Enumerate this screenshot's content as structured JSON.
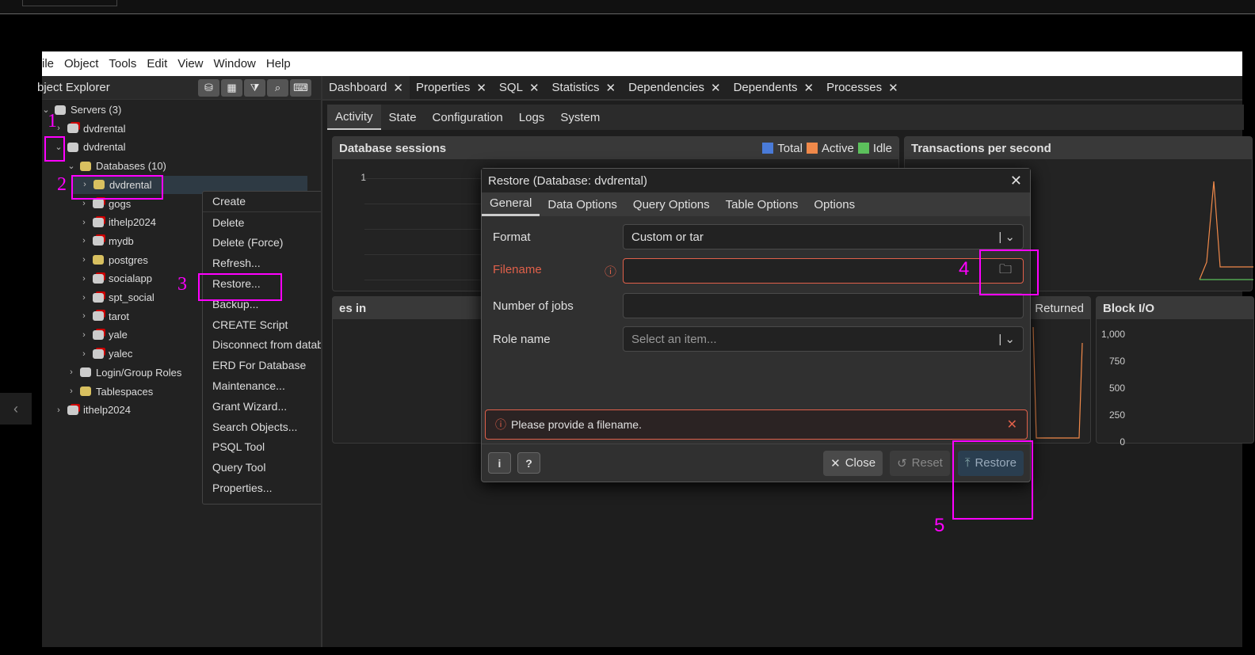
{
  "menubar": [
    "ile",
    "Object",
    "Tools",
    "Edit",
    "View",
    "Window",
    "Help"
  ],
  "explorer": {
    "title": "bject Explorer",
    "toolbar": [
      "query-tool-icon",
      "table-icon",
      "filter-icon",
      "search-icon",
      "terminal-icon"
    ],
    "tree": [
      {
        "label": "Servers (3)",
        "level": 0,
        "icon": "servers"
      },
      {
        "label": "dvdrental",
        "level": 1,
        "icon": "server-disconnected"
      },
      {
        "label": "dvdrental",
        "level": 1,
        "icon": "server-connected"
      },
      {
        "label": "Databases (10)",
        "level": 2,
        "icon": "databases"
      },
      {
        "label": "dvdrental",
        "level": 3,
        "icon": "database",
        "selected": true
      },
      {
        "label": "gogs",
        "level": 3,
        "icon": "database-disconnected"
      },
      {
        "label": "ithelp2024",
        "level": 3,
        "icon": "database-disconnected"
      },
      {
        "label": "mydb",
        "level": 3,
        "icon": "database-disconnected"
      },
      {
        "label": "postgres",
        "level": 3,
        "icon": "database"
      },
      {
        "label": "socialapp",
        "level": 3,
        "icon": "database-disconnected"
      },
      {
        "label": "spt_social",
        "level": 3,
        "icon": "database-disconnected"
      },
      {
        "label": "tarot",
        "level": 3,
        "icon": "database-disconnected"
      },
      {
        "label": "yale",
        "level": 3,
        "icon": "database-disconnected"
      },
      {
        "label": "yalec",
        "level": 3,
        "icon": "database-disconnected"
      },
      {
        "label": "Login/Group Roles",
        "level": 2,
        "icon": "roles"
      },
      {
        "label": "Tablespaces",
        "level": 2,
        "icon": "tablespaces"
      },
      {
        "label": "ithelp2024",
        "level": 1,
        "icon": "server-disconnected"
      }
    ]
  },
  "context_menu": [
    "Create",
    "Delete",
    "Delete (Force)",
    "Refresh...",
    "Restore...",
    "Backup...",
    "CREATE Script",
    "Disconnect from database",
    "ERD For Database",
    "Maintenance...",
    "Grant Wizard...",
    "Search Objects...",
    "PSQL Tool",
    "Query Tool",
    "Properties..."
  ],
  "main_tabs": [
    "Dashboard",
    "Properties",
    "SQL",
    "Statistics",
    "Dependencies",
    "Dependents",
    "Processes"
  ],
  "dash_tabs": [
    "Activity",
    "State",
    "Configuration",
    "Logs",
    "System"
  ],
  "panels": {
    "sessions": {
      "title": "Database sessions",
      "legend": [
        {
          "name": "Total",
          "color": "#4a7bd8"
        },
        {
          "name": "Active",
          "color": "#f0894a"
        },
        {
          "name": "Idle",
          "color": "#5cc05c"
        }
      ],
      "ytick": "1"
    },
    "tps": {
      "title": "Transactions per second"
    },
    "tuples_in": {
      "title": "es in"
    },
    "tuples_out": {
      "legend": "Returned"
    },
    "blockio": {
      "title": "Block I/O",
      "yticks": [
        "1,000",
        "750",
        "500",
        "250",
        "0"
      ]
    }
  },
  "dialog": {
    "title": "Restore (Database: dvdrental)",
    "tabs": [
      "General",
      "Data Options",
      "Query Options",
      "Table Options",
      "Options"
    ],
    "format_label": "Format",
    "format_value": "Custom or tar",
    "filename_label": "Filename",
    "filename_value": "",
    "jobs_label": "Number of jobs",
    "jobs_value": "",
    "role_label": "Role name",
    "role_placeholder": "Select an item...",
    "error": "Please provide a filename.",
    "close": "Close",
    "reset": "Reset",
    "restore": "Restore",
    "error_color": "#e0604a"
  },
  "annotations": [
    "1",
    "2",
    "3",
    "4",
    "5"
  ]
}
